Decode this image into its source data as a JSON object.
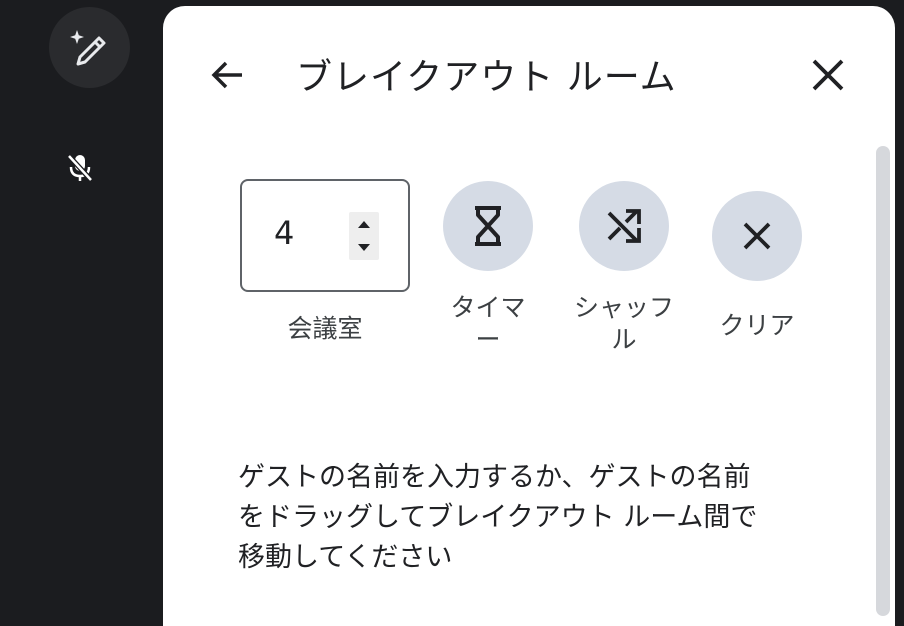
{
  "header": {
    "title": "ブレイクアウト ルーム"
  },
  "rooms": {
    "value": "4",
    "label": "会議室"
  },
  "actions": {
    "timer": {
      "line1": "タイマ",
      "line2": "ー"
    },
    "shuffle": {
      "line1": "シャッフ",
      "line2": "ル"
    },
    "clear": {
      "label": "クリア"
    }
  },
  "instructions": {
    "line1": "ゲストの名前を入力するか、ゲストの名前",
    "line2": "をドラッグしてブレイクアウト ルーム間で",
    "line3": "移動してください"
  },
  "icons": {
    "rail_fab": "magic-pen-icon",
    "rail_mic": "mic-off-icon",
    "back": "arrow-back-icon",
    "close": "close-icon",
    "timer": "hourglass-icon",
    "shuffle": "shuffle-icon",
    "clear": "clear-icon"
  },
  "colors": {
    "background": "#1b1c1f",
    "panel": "#ffffff",
    "action_bg": "#d5dbe5",
    "text": "#202124"
  }
}
